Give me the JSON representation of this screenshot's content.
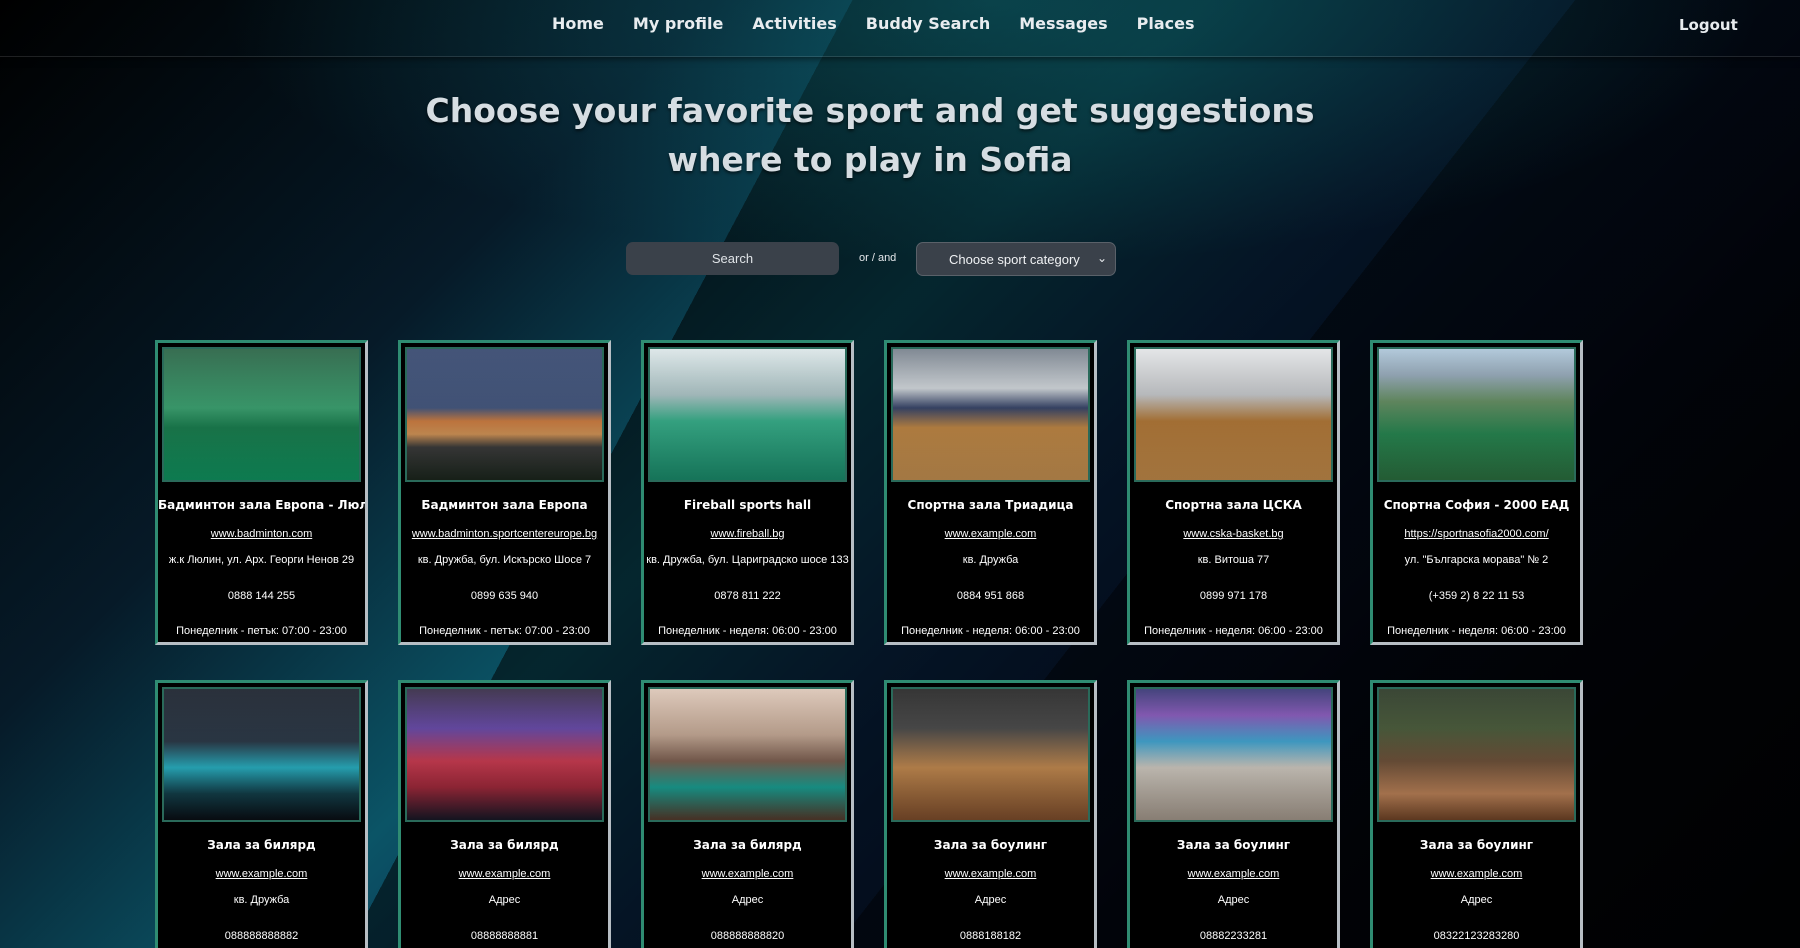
{
  "nav": {
    "items": [
      {
        "label": "Home"
      },
      {
        "label": "My profile"
      },
      {
        "label": "Activities"
      },
      {
        "label": "Buddy Search"
      },
      {
        "label": "Messages"
      },
      {
        "label": "Places"
      }
    ],
    "logout_label": "Logout"
  },
  "headline": "Choose your favorite sport and get suggestions where to play in Sofia",
  "search": {
    "placeholder": "Search",
    "or_and": "or / and",
    "category_selected": "Choose sport category"
  },
  "colors": {
    "card_border_accent": "#2f8c72",
    "card_border_light": "#b7bec4",
    "search_bg": "#3a414a"
  },
  "places": [
    {
      "title": "Бадминтон зала Европа - Люлин",
      "link": "www.badminton.com",
      "address": "ж.к Люлин, ул. Арх. Георги Ненов 29",
      "phone": "0888 144 255",
      "hours": "Понеделник - петък: 07:00 - 23:00",
      "image": "badminton-court-image"
    },
    {
      "title": "Бадминтон зала Европа",
      "link": "www.badminton.sportcentereurope.bg",
      "address": "кв. Дружба, бул. Искърско Шосе 7",
      "phone": "0899 635 940",
      "hours": "Понеделник - петък: 07:00 - 23:00",
      "image": "sport-center-building-image"
    },
    {
      "title": "Fireball sports hall",
      "link": "www.fireball.bg",
      "address": "кв. Дружба, бул. Цариградско шосе 133",
      "phone": "0878 811 222",
      "hours": "Понеделник - неделя: 06:00 - 23:00",
      "image": "indoor-hall-image"
    },
    {
      "title": "Спортна зала Триадица",
      "link": "www.example.com",
      "address": "кв. Дружба",
      "phone": "0884 951 868",
      "hours": "Понеделник - неделя: 06:00 - 23:00",
      "image": "basketball-court-image"
    },
    {
      "title": "Спортна зала ЦСКА",
      "link": "www.cska-basket.bg",
      "address": "кв. Витоша 77",
      "phone": "0899 971 178",
      "hours": "Понеделник - неделя: 06:00 - 23:00",
      "image": "basketball-court-image"
    },
    {
      "title": "Спортна София - 2000 ЕАД",
      "link": "https://sportnasofia2000.com/",
      "address": "ул. \"Българска морава\" № 2",
      "phone": "(+359 2) 8 22 11 53",
      "hours": "Понеделник - неделя: 06:00 - 23:00",
      "image": "aerial-sports-complex-image"
    },
    {
      "title": "Зала за билярд",
      "link": "www.example.com",
      "address": "кв. Дружба",
      "phone": "088888888882",
      "hours": "",
      "image": "billiard-room-image"
    },
    {
      "title": "Зала за билярд",
      "link": "www.example.com",
      "address": "Адрес",
      "phone": "08888888881",
      "hours": "",
      "image": "billiard-table-image"
    },
    {
      "title": "Зала за билярд",
      "link": "www.example.com",
      "address": "Адрес",
      "phone": "088888888820",
      "hours": "",
      "image": "billiard-lounge-image"
    },
    {
      "title": "Зала за боулинг",
      "link": "www.example.com",
      "address": "Адрес",
      "phone": "0888188182",
      "hours": "",
      "image": "bowling-alley-image"
    },
    {
      "title": "Зала за боулинг",
      "link": "www.example.com",
      "address": "Адрес",
      "phone": "08882233281",
      "hours": "",
      "image": "bowling-lanes-image"
    },
    {
      "title": "Зала за боулинг",
      "link": "www.example.com",
      "address": "Адрес",
      "phone": "08322123283280",
      "hours": "",
      "image": "bowling-center-image"
    }
  ]
}
